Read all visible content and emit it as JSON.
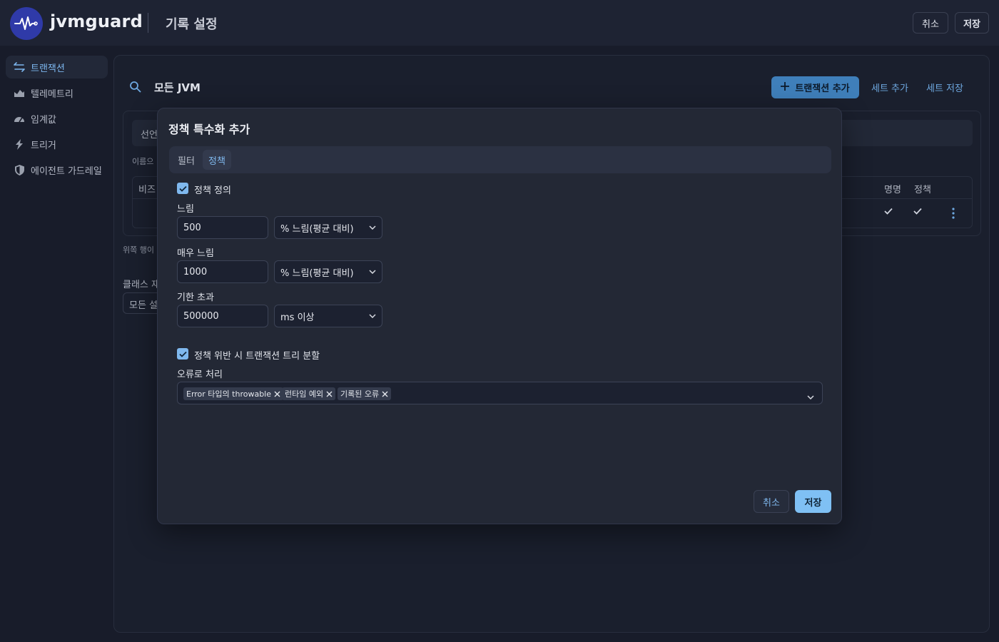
{
  "header": {
    "brand": "jvmguard",
    "title": "기록 설정",
    "cancel_label": "취소",
    "save_label": "저장",
    "logo_icon": "pulse-icon",
    "logo_color": "#2f3aa8"
  },
  "sidebar": {
    "items": [
      {
        "label": "트랜잭션",
        "icon": "transactions-icon",
        "active": true
      },
      {
        "label": "텔레메트리",
        "icon": "telemetry-chart-icon",
        "active": false
      },
      {
        "label": "임계값",
        "icon": "gauge-icon",
        "active": false
      },
      {
        "label": "트리거",
        "icon": "lightning-icon",
        "active": false
      },
      {
        "label": "에이전트 가드레일",
        "icon": "shield-icon",
        "active": false
      }
    ]
  },
  "background": {
    "search_text": "모든 JVM",
    "add_transaction_label": "트랜잭션 추가",
    "add_set_label": "세트 추가",
    "save_set_label": "세트 저장",
    "tab_partial": "선언",
    "name_hint_partial": "이름으",
    "column_partial": "비즈",
    "column_naming": "명명",
    "column_policy": "정책",
    "footer_hint_partial": "위쪽 행이 [",
    "class_label_partial": "클래스 재",
    "class_select_partial": "모든 설"
  },
  "modal": {
    "title": "정책 특수화 추가",
    "tabs": [
      {
        "label": "필터",
        "active": false
      },
      {
        "label": "정책",
        "active": true
      }
    ],
    "policy_definition": {
      "label": "정책 정의",
      "checked": true
    },
    "slow": {
      "label": "느림",
      "value": "500",
      "unit": "% 느림(평균 대비)"
    },
    "very_slow": {
      "label": "매우 느림",
      "value": "1000",
      "unit": "% 느림(평균 대비)"
    },
    "overdue": {
      "label": "기한 초과",
      "value": "500000",
      "unit": "ms 이상"
    },
    "split_tree": {
      "label": "정책 위반 시 트랜잭션 트리 분할",
      "checked": true
    },
    "error_handling": {
      "label": "오류로 처리",
      "chips": [
        "Error 타입의 throwable",
        "런타임 예외",
        "기록된 오류"
      ]
    },
    "cancel_label": "취소",
    "save_label": "저장"
  },
  "colors": {
    "accent": "#7fb8ee",
    "primary_button": "#7fc0f4",
    "background": "#181c2a"
  }
}
